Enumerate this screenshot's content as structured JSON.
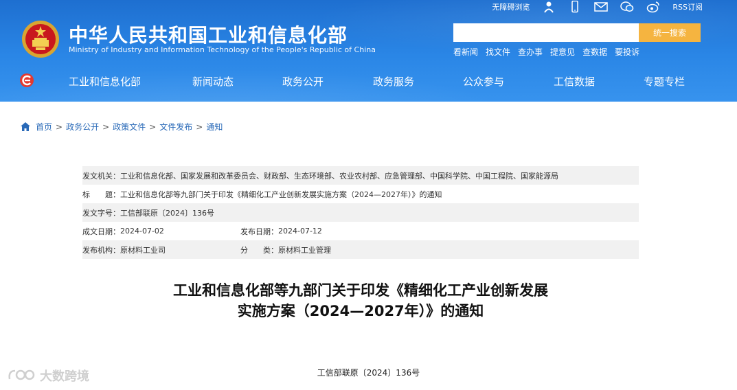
{
  "header": {
    "title": "中华人民共和国工业和信息化部",
    "subtitle": "Ministry of Industry and Information Technology of the People's Republic of China",
    "top_tools": {
      "accessibility": "无障碍浏览",
      "rss": "RSS订阅"
    },
    "search": {
      "placeholder": "",
      "button": "统一搜索"
    },
    "quick_links": [
      "看新闻",
      "找文件",
      "查办事",
      "提意见",
      "查数据",
      "要投诉"
    ],
    "nav": [
      "工业和信息化部",
      "新闻动态",
      "政务公开",
      "政务服务",
      "公众参与",
      "工信数据",
      "专题专栏"
    ]
  },
  "breadcrumb": [
    "首页",
    "政务公开",
    "政策文件",
    "文件发布",
    "通知"
  ],
  "breadcrumb_sep": ">",
  "info": {
    "issuer_label": "发文机关：",
    "issuer": "工业和信息化部、国家发展和改革委员会、财政部、生态环境部、农业农村部、应急管理部、中国科学院、中国工程院、国家能源局",
    "title_label": "标　　题：",
    "title": "工业和信息化部等九部门关于印发《精细化工产业创新发展实施方案（2024—2027年）》的通知",
    "docno_label": "发文字号：",
    "docno": "工信部联原〔2024〕136号",
    "created_label": "成文日期：",
    "created": "2024-07-02",
    "published_label": "发布日期：",
    "published": "2024-07-12",
    "org_label": "发布机构：",
    "org": "原材料工业司",
    "category_label": "分　　类：",
    "category": "原材料工业管理"
  },
  "article": {
    "title_line1": "工业和信息化部等九部门关于印发《精细化工产业创新发展",
    "title_line2": "实施方案（2024—2027年）》的通知",
    "doc_number": "工信部联原〔2024〕136号"
  },
  "watermark": "大数跨境",
  "colors": {
    "header_blue": "#2a86e6",
    "search_button": "#f5b440",
    "breadcrumb_link": "#2a6ab8",
    "row_shade": "#f1f1f1"
  }
}
